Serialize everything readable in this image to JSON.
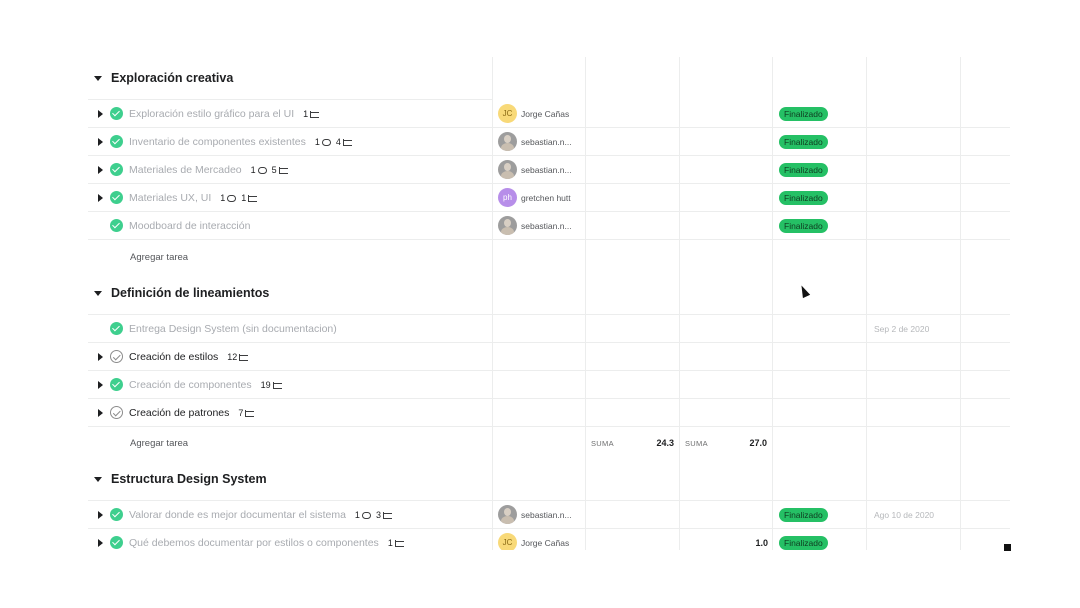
{
  "sections": [
    {
      "title": "Exploración creativa",
      "tasks": [
        {
          "name": "Exploración estilo gráfico para el UI",
          "comments": "",
          "subtasks": "1",
          "assignee": "Jorge Cañas",
          "avatar_initials": "JC",
          "status": "Finalizado"
        },
        {
          "name": "Inventario de componentes existentes",
          "comments": "1",
          "subtasks": "4",
          "assignee": "sebastian.n...",
          "status": "Finalizado"
        },
        {
          "name": "Materiales de Mercadeo",
          "comments": "1",
          "subtasks": "5",
          "assignee": "sebastian.n...",
          "status": "Finalizado"
        },
        {
          "name": "Materiales UX, UI",
          "comments": "1",
          "subtasks": "1",
          "assignee": "gretchen hutt",
          "avatar_initials": "ph",
          "status": "Finalizado"
        },
        {
          "name": "Moodboard de interacción",
          "assignee": "sebastian.n...",
          "status": "Finalizado"
        }
      ],
      "add_task_label": "Agregar tarea"
    },
    {
      "title": "Definición de lineamientos",
      "tasks": [
        {
          "name": "Entrega Design System (sin documentacion)",
          "date": "Sep 2 de 2020"
        },
        {
          "name": "Creación de estilos",
          "subtasks": "12"
        },
        {
          "name": "Creación de componentes",
          "subtasks": "19"
        },
        {
          "name": "Creación de patrones",
          "subtasks": "7"
        }
      ],
      "add_task_label": "Agregar tarea",
      "sum_label_1": "SUMA",
      "sum_value_1": "24.3",
      "sum_label_2": "SUMA",
      "sum_value_2": "27.0"
    },
    {
      "title": "Estructura Design System",
      "tasks": [
        {
          "name": "Valorar donde es mejor documentar el sistema",
          "comments": "1",
          "subtasks": "3",
          "assignee": "sebastian.n...",
          "status": "Finalizado",
          "date": "Ago 10 de 2020"
        },
        {
          "name": "Qué debemos documentar por estilos o componentes",
          "subtasks": "1",
          "assignee": "Jorge Cañas",
          "avatar_initials": "JC",
          "number": "1.0",
          "status": "Finalizado"
        }
      ]
    }
  ],
  "colors": {
    "status_green": "#25c065",
    "check_green": "#3ecf8e",
    "completed_text": "#a8abb0",
    "grid_line": "#eceded"
  },
  "icons": [
    "caret-down-icon",
    "caret-right-icon",
    "check-circle-icon",
    "comment-icon",
    "subtask-icon",
    "drag-handle-icon",
    "mouse-cursor-icon"
  ]
}
